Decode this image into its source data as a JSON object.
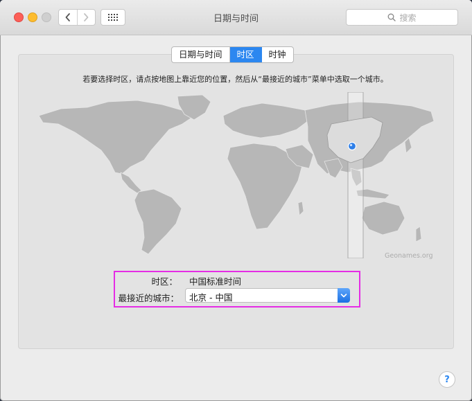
{
  "window": {
    "title": "日期与时间"
  },
  "toolbar": {
    "search_placeholder": "搜索"
  },
  "tabs": [
    {
      "label": "日期与时间",
      "selected": false
    },
    {
      "label": "时区",
      "selected": true
    },
    {
      "label": "时钟",
      "selected": false
    }
  ],
  "instructions": "若要选择时区，请点按地图上靠近您的位置，然后从“最接近的城市”菜单中选取一个城市。",
  "map": {
    "credit": "Geonames.org"
  },
  "timezone": {
    "label": "时区：",
    "value": "中国标准时间",
    "city_label": "最接近的城市：",
    "city_value": "北京 - 中国"
  },
  "colors": {
    "accent": "#2c87f0",
    "highlight": "#e52ce5"
  },
  "icons": [
    "back-chevron-icon",
    "forward-chevron-icon",
    "grid-icon",
    "magnifier-icon",
    "popup-chevron-icon",
    "location-pin-icon"
  ]
}
